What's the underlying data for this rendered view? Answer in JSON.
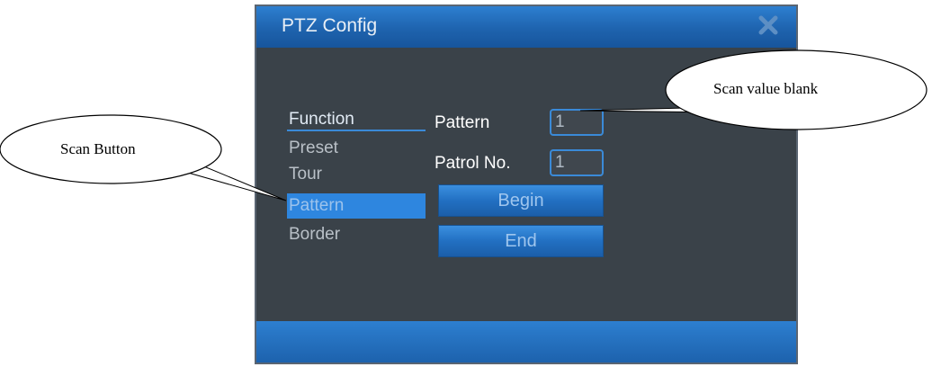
{
  "dialog": {
    "title": "PTZ Config",
    "close_icon": "close-x-icon"
  },
  "menu": {
    "items": [
      {
        "label": "Function"
      },
      {
        "label": "Preset"
      },
      {
        "label": "Tour"
      },
      {
        "label": "Pattern"
      },
      {
        "label": "Border"
      }
    ],
    "active": "Function",
    "highlighted": "Pattern"
  },
  "form": {
    "pattern_label": "Pattern",
    "pattern_value": "1",
    "patrol_label": "Patrol No.",
    "patrol_value": "1",
    "begin_label": "Begin",
    "end_label": "End"
  },
  "annotations": {
    "scan_value": "Scan value blank",
    "scan_button": "Scan Button"
  },
  "colors": {
    "accent": "#2e86df",
    "panel": "#3a4249"
  }
}
